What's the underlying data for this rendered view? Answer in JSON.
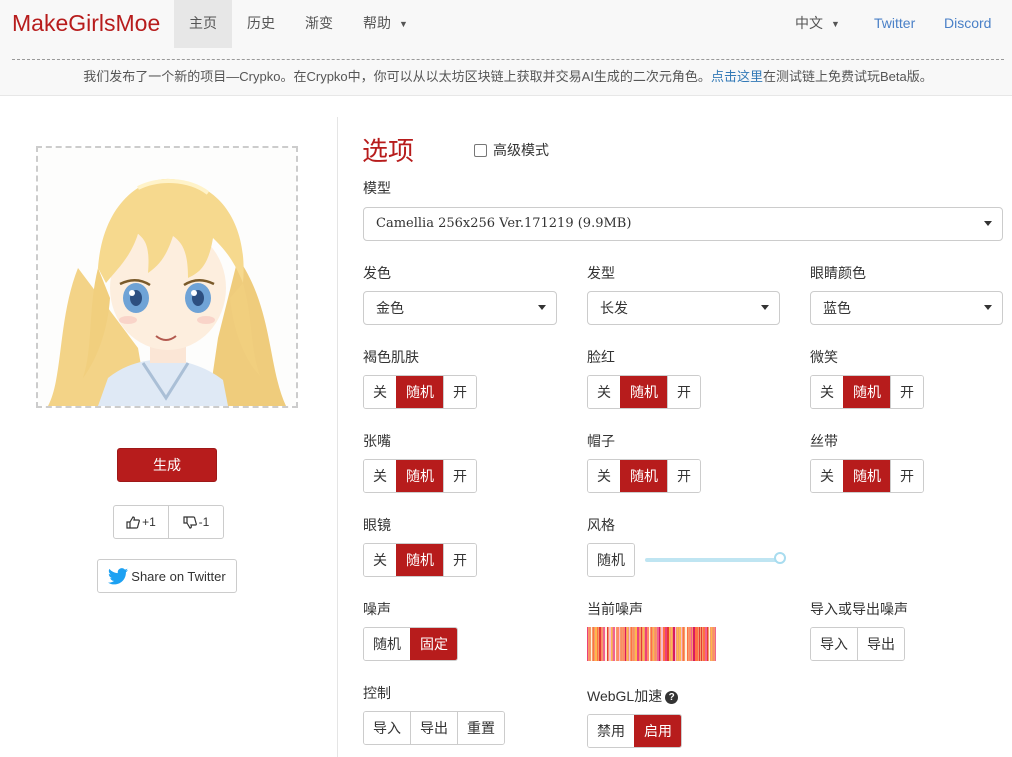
{
  "nav": {
    "brand": "MakeGirlsMoe",
    "items": [
      "主页",
      "历史",
      "渐变",
      "帮助"
    ],
    "language": "中文",
    "twitter": "Twitter",
    "discord": "Discord"
  },
  "notice": {
    "text_before": "我们发布了一个新的项目—Crypko。在Crypko中，你可以从以太坊区块链上获取并交易AI生成的二次元角色。",
    "link": "点击这里",
    "text_after": "在测试链上免费试玩Beta版。"
  },
  "left": {
    "generate": "生成",
    "upvote": "+1",
    "downvote": "-1",
    "share": "Share on Twitter"
  },
  "options": {
    "title": "选项",
    "advanced": "高级模式",
    "model_label": "模型",
    "model_value": "Camellia 256x256 Ver.171219 (9.9MB)",
    "hair_color_label": "发色",
    "hair_color_value": "金色",
    "hair_style_label": "发型",
    "hair_style_value": "长发",
    "eye_color_label": "眼睛颜色",
    "eye_color_value": "蓝色",
    "toggles": {
      "off": "关",
      "random": "随机",
      "on": "开",
      "dark_skin": "褐色肌肤",
      "blush": "脸红",
      "smile": "微笑",
      "open_mouth": "张嘴",
      "hat": "帽子",
      "ribbon": "丝带",
      "glasses": "眼镜"
    },
    "style_label": "风格",
    "style_random": "随机",
    "style_level": 1.0,
    "noise_label": "噪声",
    "noise_random": "随机",
    "noise_fixed": "固定",
    "current_noise_label": "当前噪声",
    "io_noise_label": "导入或导出噪声",
    "import": "导入",
    "export": "导出",
    "control_label": "控制",
    "reset": "重置",
    "webgl_label": "WebGL加速",
    "webgl_disable": "禁用",
    "webgl_enable": "启用"
  },
  "colors": {
    "accent": "#b71c1c",
    "link": "#4a80c7"
  }
}
